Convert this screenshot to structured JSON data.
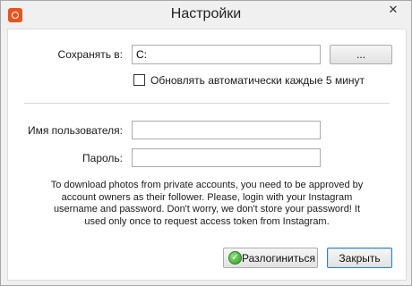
{
  "window": {
    "title": "Настройки",
    "close_glyph": "✕",
    "icon": "app-icon"
  },
  "settings": {
    "save_label": "Сохранять в:",
    "save_path": "C:",
    "browse_label": "...",
    "auto_update_label": "Обновлять автоматически каждые 5 минут",
    "auto_update_checked": false
  },
  "login": {
    "username_label": "Имя пользователя:",
    "username_value": "",
    "password_label": "Пароль:",
    "password_value": "",
    "info_text": "To download photos from private accounts, you need to be approved by account owners as their follower. Please, login with your Instagram username and password. Don't worry, we don't store your password! It used only once to request access token from Instagram."
  },
  "footer": {
    "logout_label": "Разлогиниться",
    "logout_icon": "check-circle-icon",
    "close_label": "Закрыть"
  }
}
